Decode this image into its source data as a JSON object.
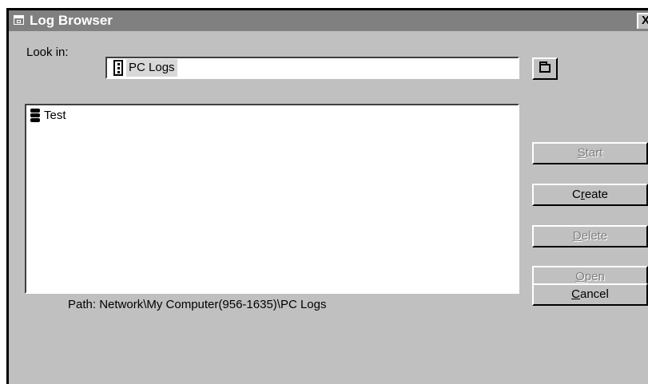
{
  "window": {
    "title": "Log Browser",
    "close_label": "X"
  },
  "look_in": {
    "label": "Look in:",
    "value": "PC Logs"
  },
  "icons": {
    "title": "window-icon",
    "combo": "log-folder-icon",
    "up_folder": "up-folder-icon",
    "item": "log-item-icon"
  },
  "list": {
    "items": [
      {
        "label": "Test"
      }
    ]
  },
  "buttons": {
    "start": {
      "pre": "",
      "key": "S",
      "post": "tart",
      "enabled": false
    },
    "create": {
      "pre": "C",
      "key": "r",
      "post": "eate",
      "enabled": true
    },
    "delete": {
      "pre": "",
      "key": "D",
      "post": "elete",
      "enabled": false
    },
    "open": {
      "pre": "",
      "key": "O",
      "post": "pen",
      "enabled": false
    },
    "cancel": {
      "pre": "",
      "key": "C",
      "post": "ancel",
      "enabled": true
    }
  },
  "path": {
    "text": "Path: Network\\My Computer(956-1635)\\PC Logs"
  },
  "colors": {
    "titlebar": "#808080",
    "face": "#c0c0c0",
    "disabled_text": "#808080"
  }
}
